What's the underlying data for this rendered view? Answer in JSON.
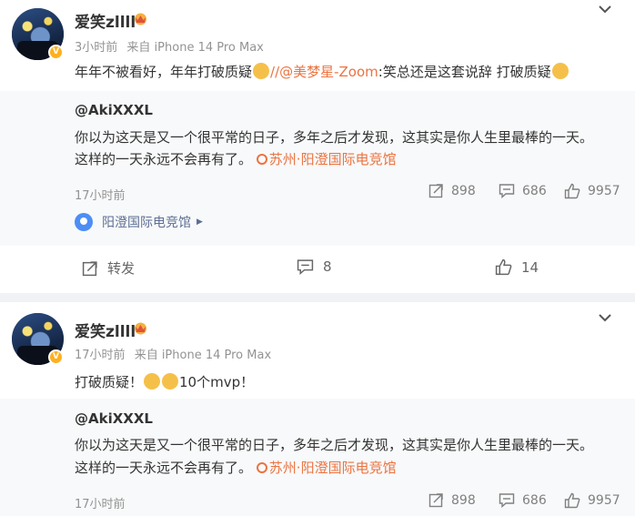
{
  "posts": [
    {
      "username": "爱笑zllll",
      "time": "3小时前",
      "source": "来自 iPhone 14 Pro Max",
      "text_prefix": "年年不被看好，年年打破质疑",
      "text_mention": "//@美梦星-Zoom",
      "text_suffix": ":笑总还是这套说辞 打破质疑",
      "repost": {
        "author": "@AkiXXXL",
        "line1": "你以为这天是又一个很平常的日子，多年之后才发现，这其实是你人生里最棒的一天。",
        "line2": "这样的一天永远不会再有了。",
        "location": "苏州·阳澄国际电竞馆",
        "time": "17小时前",
        "reposts": "898",
        "comments": "686",
        "likes": "9957"
      },
      "place": "阳澄国际电竞馆",
      "actions": {
        "repost": "转发",
        "comments": "8",
        "likes": "14"
      }
    },
    {
      "username": "爱笑zllll",
      "time": "17小时前",
      "source": "来自 iPhone 14 Pro Max",
      "text_prefix": "打破质疑！",
      "text_suffix": "10个mvp！",
      "repost": {
        "author": "@AkiXXXL",
        "line1": "你以为这天是又一个很平常的日子，多年之后才发现，这其实是你人生里最棒的一天。",
        "line2": "这样的一天永远不会再有了。",
        "location": "苏州·阳澄国际电竞馆",
        "time": "17小时前",
        "reposts": "898",
        "comments": "686",
        "likes": "9957"
      }
    }
  ],
  "icons": {
    "badge": "v-verified-icon",
    "crown": "crown-icon",
    "menu": "chevron-down-icon",
    "repost": "repost-icon",
    "comment": "comment-icon",
    "like": "thumbs-up-icon",
    "location": "location-pin-icon"
  },
  "colors": {
    "mention": "#eb7340",
    "place": "#5d6f94",
    "pin": "#4d8ef5",
    "badge": "#ffb01f"
  }
}
